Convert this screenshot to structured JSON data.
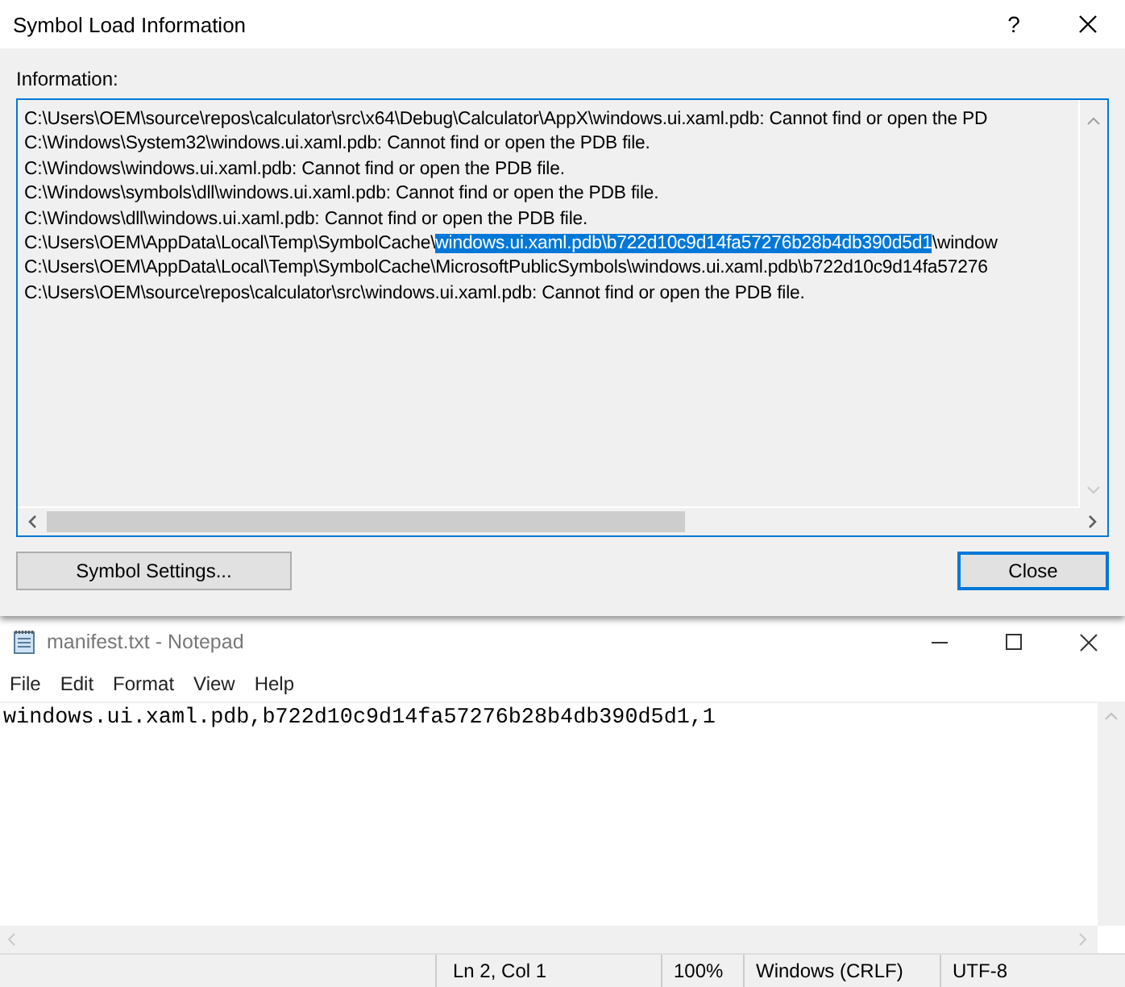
{
  "dialog": {
    "title": "Symbol Load Information",
    "help": "?",
    "info_label": "Information:",
    "lines": [
      {
        "parts": [
          {
            "text": "C:\\Users\\OEM\\source\\repos\\calculator\\src\\x64\\Debug\\Calculator\\AppX\\windows.ui.xaml.pdb: Cannot find or open the PD",
            "selected": false
          }
        ]
      },
      {
        "parts": [
          {
            "text": "C:\\Windows\\System32\\windows.ui.xaml.pdb: Cannot find or open the PDB file.",
            "selected": false
          }
        ]
      },
      {
        "parts": [
          {
            "text": "C:\\Windows\\windows.ui.xaml.pdb: Cannot find or open the PDB file.",
            "selected": false
          }
        ]
      },
      {
        "parts": [
          {
            "text": "C:\\Windows\\symbols\\dll\\windows.ui.xaml.pdb: Cannot find or open the PDB file.",
            "selected": false
          }
        ]
      },
      {
        "parts": [
          {
            "text": "C:\\Windows\\dll\\windows.ui.xaml.pdb: Cannot find or open the PDB file.",
            "selected": false
          }
        ]
      },
      {
        "parts": [
          {
            "text": "C:\\Users\\OEM\\AppData\\Local\\Temp\\SymbolCache\\",
            "selected": false
          },
          {
            "text": "windows.ui.xaml.pdb\\b722d10c9d14fa57276b28b4db390d5d1",
            "selected": true
          },
          {
            "text": "\\window",
            "selected": false
          }
        ]
      },
      {
        "parts": [
          {
            "text": "C:\\Users\\OEM\\AppData\\Local\\Temp\\SymbolCache\\MicrosoftPublicSymbols\\windows.ui.xaml.pdb\\b722d10c9d14fa57276",
            "selected": false
          }
        ]
      },
      {
        "parts": [
          {
            "text": "C:\\Users\\OEM\\source\\repos\\calculator\\src\\windows.ui.xaml.pdb: Cannot find or open the PDB file.",
            "selected": false
          }
        ]
      }
    ],
    "buttons": [
      {
        "label": "Symbol Settings...",
        "default": false
      },
      {
        "label": "Close",
        "default": true
      }
    ]
  },
  "notepad": {
    "title": "manifest.txt - Notepad",
    "menu": [
      "File",
      "Edit",
      "Format",
      "View",
      "Help"
    ],
    "content": "windows.ui.xaml.pdb,b722d10c9d14fa57276b28b4db390d5d1,1",
    "status_bar": [
      "Ln 2, Col 1",
      "100%",
      "Windows (CRLF)",
      "UTF-8"
    ]
  }
}
